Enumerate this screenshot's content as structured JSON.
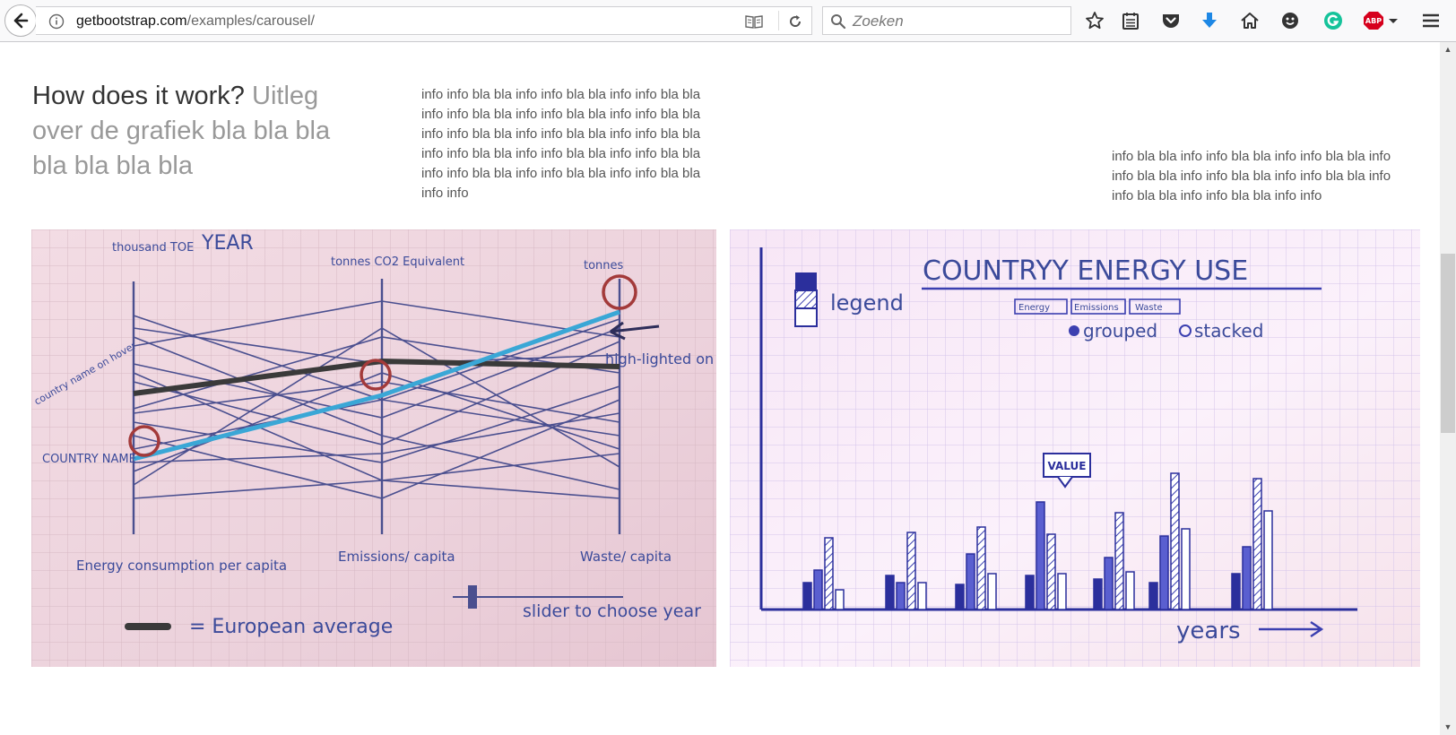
{
  "browser": {
    "url_host": "getbootstrap.com",
    "url_path": "/examples/carousel/",
    "search_placeholder": "Zoeken",
    "extension_badge": "ABP"
  },
  "section": {
    "heading_main": "How does it work?",
    "heading_muted": "Uitleg over de grafiek bla bla bla bla bla bla bla",
    "info_middle": "info info bla bla info info bla bla info info bla bla info info bla bla info info bla bla info info bla bla info info bla bla info info bla bla info info bla bla info info bla bla info info bla bla info info bla bla info info bla bla info info bla bla info info bla bla info info",
    "info_right": "info bla bla info info bla bla info info bla bla info info bla bla info info bla bla info info bla bla info info bla bla info info bla bla info info"
  },
  "sketch_left": {
    "axis1_unit": "thousand TOE",
    "year_label": "YEAR",
    "axis2_unit": "tonnes CO2 Equivalent",
    "axis3_unit": "tonnes",
    "highlight_note": "high-lighted on hover",
    "side_note": "country name on hover",
    "country_label": "COUNTRY NAME",
    "axis1_name": "Energy consumption per capita",
    "axis2_name": "Emissions/ capita",
    "axis3_name": "Waste/ capita",
    "legend_text": "= European average",
    "slider_text": "slider to choose year"
  },
  "sketch_right": {
    "title": "COUNTRYY ENERGY USE",
    "legend_label": "legend",
    "tag1": "Energy",
    "tag2": "Emissions",
    "tag3": "Waste",
    "option1": "grouped",
    "option2": "stacked",
    "tooltip": "VALUE",
    "x_label": "years",
    "bar_heights": [
      [
        30,
        44,
        80,
        22
      ],
      [
        38,
        30,
        86,
        30
      ],
      [
        28,
        62,
        92,
        40
      ],
      [
        38,
        120,
        84,
        40
      ],
      [
        34,
        58,
        108,
        42
      ],
      [
        30,
        82,
        152,
        90
      ],
      [
        40,
        70,
        146,
        110
      ]
    ]
  },
  "colors": {
    "ink": "#3b4a9a",
    "highlight_blue": "#3aa7d6",
    "average_line": "#3a3a3a",
    "circle_red": "#a33a3a"
  }
}
